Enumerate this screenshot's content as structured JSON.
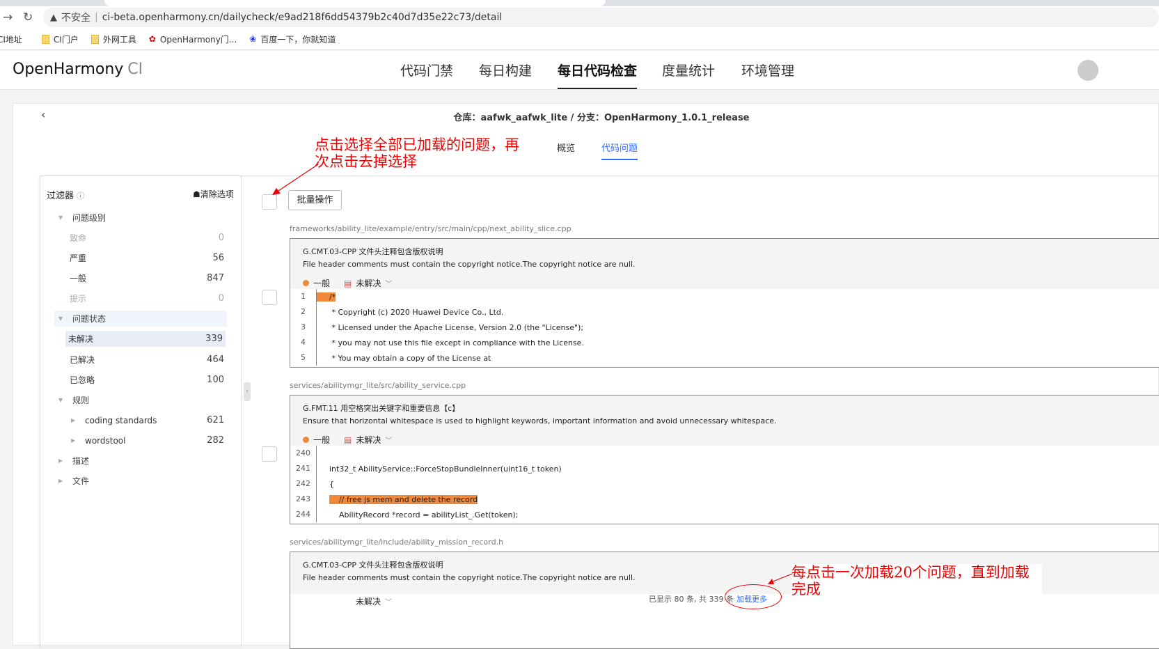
{
  "browser": {
    "security_label": "不安全",
    "url": "ci-beta.openharmony.cn/dailycheck/e9ad218f6dd54379b2c40d7d35e22c73/detail",
    "bookmarks": [
      {
        "label": "CI地址"
      },
      {
        "label": "CI门户"
      },
      {
        "label": "外网工具"
      },
      {
        "label": "OpenHarmony门..."
      },
      {
        "label": "百度一下，你就知道"
      }
    ]
  },
  "header": {
    "logo": "OpenHarmony",
    "logo_suffix": "CI",
    "nav": [
      "代码门禁",
      "每日构建",
      "每日代码检查",
      "度量统计",
      "环境管理"
    ],
    "active_nav": "每日代码检查"
  },
  "page": {
    "title": "仓库：aafwk_aafwk_lite / 分支：OpenHarmony_1.0.1_release",
    "tabs": [
      "概览",
      "代码问题"
    ],
    "active_tab": "代码问题"
  },
  "filter": {
    "title": "过滤器",
    "clear": "清除选项",
    "groups": [
      {
        "label": "问题级别",
        "items": [
          {
            "label": "致命",
            "count": "0"
          },
          {
            "label": "严重",
            "count": "56"
          },
          {
            "label": "一般",
            "count": "847"
          },
          {
            "label": "提示",
            "count": "0"
          }
        ]
      },
      {
        "label": "问题状态",
        "items": [
          {
            "label": "未解决",
            "count": "339"
          },
          {
            "label": "已解决",
            "count": "464"
          },
          {
            "label": "已忽略",
            "count": "100"
          }
        ]
      },
      {
        "label": "规则",
        "items": [
          {
            "label": "coding standards",
            "count": "621"
          },
          {
            "label": "wordstool",
            "count": "282"
          }
        ]
      },
      {
        "label": "描述"
      },
      {
        "label": "文件"
      }
    ]
  },
  "toolbar": {
    "batch": "批量操作"
  },
  "issues": [
    {
      "path": "frameworks/ability_lite/example/entry/src/main/cpp/next_ability_slice.cpp",
      "rule": "G.CMT.03-CPP 文件头注释包含版权说明",
      "desc": "File header comments must contain the copyright notice.The copyright notice are null.",
      "level": "一般",
      "status": "未解决",
      "lines": [
        {
          "n": "1",
          "code": "/*"
        },
        {
          "n": "2",
          "code": " * Copyright (c) 2020 Huawei Device Co., Ltd."
        },
        {
          "n": "3",
          "code": " * Licensed under the Apache License, Version 2.0 (the \"License\");"
        },
        {
          "n": "4",
          "code": " * you may not use this file except in compliance with the License."
        },
        {
          "n": "5",
          "code": " * You may obtain a copy of the License at"
        }
      ]
    },
    {
      "path": "services/abilitymgr_lite/src/ability_service.cpp",
      "rule": "G.FMT.11 用空格突出关键字和重要信息【c】",
      "desc": "Ensure that horizontal whitespace is used to highlight keywords, important information and avoid unnecessary whitespace.",
      "level": "一般",
      "status": "未解决",
      "lines": [
        {
          "n": "240",
          "code": ""
        },
        {
          "n": "241",
          "code": "int32_t AbilityService::ForceStopBundleInner(uint16_t token)"
        },
        {
          "n": "242",
          "code": "{"
        },
        {
          "n": "243",
          "code": "    // free js mem and delete the record"
        },
        {
          "n": "244",
          "code": "    AbilityRecord *record = abilityList_.Get(token);"
        }
      ]
    },
    {
      "path": "services/abilitymgr_lite/include/ability_mission_record.h",
      "rule": "G.CMT.03-CPP 文件头注释包含版权说明",
      "desc": "File header comments must contain the copyright notice.The copyright notice are null.",
      "status": "未解决"
    }
  ],
  "footer": {
    "info": "已显示 80 条, 共 339 条",
    "load_more": "加载更多"
  },
  "annotations": {
    "select_all": "点击选择全部已加载的问题，再次点击去掉选择",
    "load_more": "每点击一次加载20个问题，直到加载完成"
  },
  "colors": {
    "accent": "#2f6bff",
    "level_general": "#f0883a",
    "annotation": "#ee0000"
  }
}
